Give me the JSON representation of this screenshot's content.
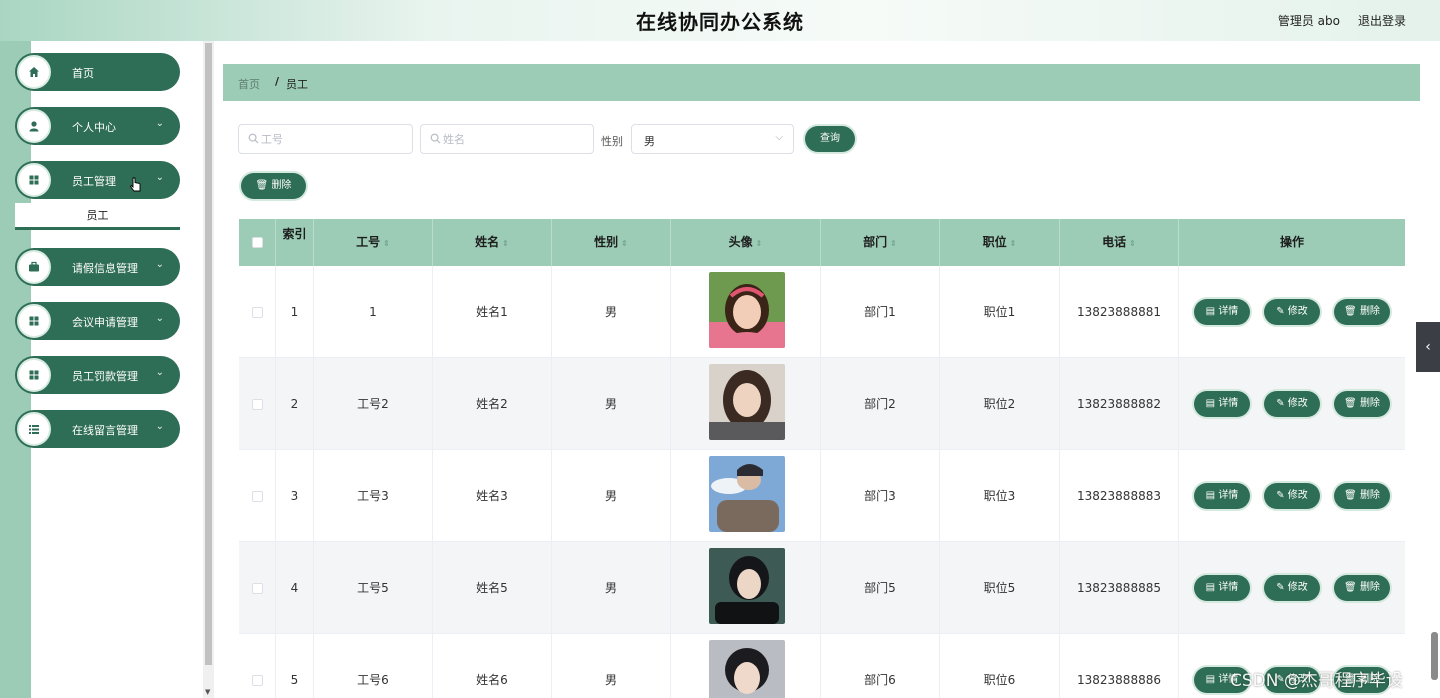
{
  "header": {
    "title": "在线协同办公系统",
    "user": "管理员 abo",
    "logout": "退出登录"
  },
  "sidebar": {
    "items": [
      {
        "label": "首页",
        "icon": "home-icon",
        "chevron": ""
      },
      {
        "label": "个人中心",
        "icon": "person-icon",
        "chevron": "⌄"
      },
      {
        "label": "员工管理",
        "icon": "grid-icon",
        "chevron": "⌄"
      },
      {
        "label": "请假信息管理",
        "icon": "briefcase-icon",
        "chevron": "⌄"
      },
      {
        "label": "会议申请管理",
        "icon": "grid-icon",
        "chevron": "⌄"
      },
      {
        "label": "员工罚款管理",
        "icon": "grid-icon",
        "chevron": "⌄"
      },
      {
        "label": "在线留言管理",
        "icon": "list-icon",
        "chevron": "⌄"
      }
    ],
    "submenu": {
      "label": "员工"
    }
  },
  "breadcrumb": {
    "home": "首页",
    "separator": "/",
    "current": "员工"
  },
  "search": {
    "id_placeholder": "工号",
    "name_placeholder": "姓名",
    "sex_label": "性别",
    "sex_value": "男",
    "query_label": "查询",
    "delete_label": "删除"
  },
  "table": {
    "headers": {
      "index": "索引",
      "id": "工号",
      "name": "姓名",
      "sex": "性别",
      "avatar": "头像",
      "dept": "部门",
      "position": "职位",
      "phone": "电话",
      "actions": "操作"
    },
    "action_labels": {
      "detail": "详情",
      "edit": "修改",
      "delete": "删除"
    },
    "rows": [
      {
        "index": "1",
        "id": "1",
        "name": "姓名1",
        "sex": "男",
        "dept": "部门1",
        "position": "职位1",
        "phone": "13823888881"
      },
      {
        "index": "2",
        "id": "工号2",
        "name": "姓名2",
        "sex": "男",
        "dept": "部门2",
        "position": "职位2",
        "phone": "13823888882"
      },
      {
        "index": "3",
        "id": "工号3",
        "name": "姓名3",
        "sex": "男",
        "dept": "部门3",
        "position": "职位3",
        "phone": "13823888883"
      },
      {
        "index": "4",
        "id": "工号5",
        "name": "姓名5",
        "sex": "男",
        "dept": "部门5",
        "position": "职位5",
        "phone": "13823888885"
      },
      {
        "index": "5",
        "id": "工号6",
        "name": "姓名6",
        "sex": "男",
        "dept": "部门6",
        "position": "职位6",
        "phone": "13823888886"
      }
    ]
  },
  "watermark": "CSDN @杰哥程序毕设",
  "colors": {
    "primary": "#2e6d56",
    "header_bg": "#9ccbb6",
    "row_alt": "#f4f5f7"
  }
}
